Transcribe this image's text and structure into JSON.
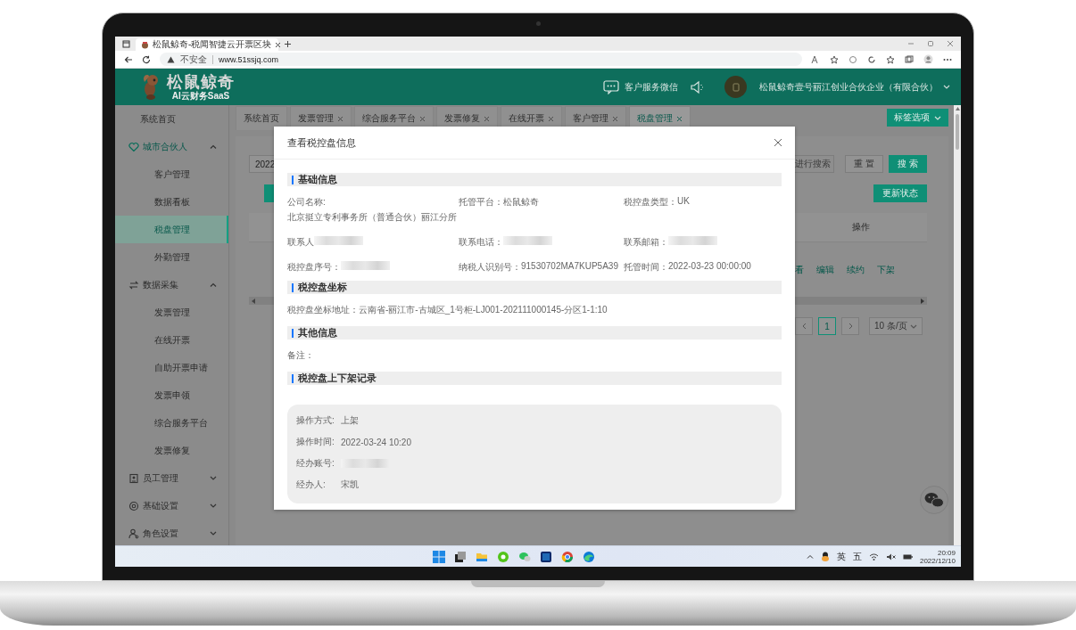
{
  "browser": {
    "tab_title": "松鼠鲸奇-税闻智捷云开票区块",
    "security": "不安全",
    "url": "www.51ssjq.com"
  },
  "header": {
    "logo": "松鼠鲸奇",
    "slogan": "AI云财务SaaS",
    "service": "客户服务微信",
    "company": "松鼠鲸奇壹号丽江创业合伙企业（有限合伙）"
  },
  "sidebar": [
    {
      "kind": "link",
      "label": "系统首页",
      "selected": false
    },
    {
      "kind": "group",
      "label": "城市合伙人",
      "expanded": true,
      "children": [
        {
          "label": "客户管理",
          "selected": false
        },
        {
          "label": "数据看板",
          "selected": false
        },
        {
          "label": "税盘管理",
          "selected": true
        },
        {
          "label": "外勤管理",
          "selected": false
        }
      ]
    },
    {
      "kind": "group",
      "label": "数据采集",
      "expanded": true,
      "children": [
        {
          "label": "发票管理",
          "selected": false
        },
        {
          "label": "在线开票",
          "selected": false
        },
        {
          "label": "自助开票申请",
          "selected": false
        },
        {
          "label": "发票申领",
          "selected": false
        },
        {
          "label": "综合服务平台",
          "selected": false
        },
        {
          "label": "发票修复",
          "selected": false
        }
      ]
    },
    {
      "kind": "group",
      "label": "员工管理",
      "expanded": false
    },
    {
      "kind": "group",
      "label": "基础设置",
      "expanded": false
    },
    {
      "kind": "group",
      "label": "角色设置",
      "expanded": false
    }
  ],
  "tabs": [
    {
      "label": "系统首页",
      "closable": false,
      "selected": false
    },
    {
      "label": "发票管理",
      "closable": true,
      "selected": false
    },
    {
      "label": "综合服务平台",
      "closable": true,
      "selected": false
    },
    {
      "label": "发票修复",
      "closable": true,
      "selected": false
    },
    {
      "label": "在线开票",
      "closable": true,
      "selected": false
    },
    {
      "label": "客户管理",
      "closable": true,
      "selected": false
    },
    {
      "label": "税盘管理",
      "closable": true,
      "selected": true
    }
  ],
  "tab_options": "标签选项",
  "toolbar": {
    "date_value": "2022",
    "search_placeholder": "进行搜索",
    "reset": "重 置",
    "search": "搜 索",
    "update": "更新状态"
  },
  "table": {
    "columns": [
      {
        "label": "操作"
      }
    ],
    "actions": [
      "看",
      "编辑",
      "续约",
      "下架"
    ]
  },
  "pagination": {
    "pages": [
      {
        "label": "1",
        "selected": true
      }
    ],
    "page_size": "10 条/页"
  },
  "modal": {
    "title": "查看税控盘信息",
    "sections": [
      {
        "title": "基础信息",
        "kind": "grid",
        "fields": [
          {
            "label": "公司名称:",
            "value": "北京挺立专利事务所（普通合伙）丽江分所",
            "kind": "stacked"
          },
          {
            "label": "托管平台：",
            "value": "松鼠鲸奇",
            "kind": "inline"
          },
          {
            "label": "税控盘类型：",
            "value": "UK",
            "kind": "inline"
          },
          {
            "label": "联系人",
            "kind": "inline",
            "redacted": true
          },
          {
            "label": "联系电话：",
            "kind": "inline",
            "redacted": true
          },
          {
            "label": "联系邮箱：",
            "kind": "inline",
            "redacted": true
          },
          {
            "label": "税控盘序号：",
            "kind": "inline",
            "redacted": true
          },
          {
            "label": "纳税人识别号：",
            "value": "91530702MA7KUP5A39",
            "kind": "inline"
          },
          {
            "label": "托管时间：",
            "value": "2022-03-23 00:00:00",
            "kind": "inline"
          }
        ]
      },
      {
        "title": "税控盘坐标",
        "kind": "list",
        "fields": [
          {
            "label": "税控盘坐标地址：",
            "value": "云南省-丽江市-古城区_1号柜-LJ001-202111000145-分区1-1:10",
            "kind": "inline"
          }
        ]
      },
      {
        "title": "其他信息",
        "kind": "list",
        "fields": [
          {
            "label": "备注：",
            "kind": "inline"
          }
        ]
      },
      {
        "title": "税控盘上下架记录",
        "kind": "record",
        "fields": [
          {
            "label": "操作方式:",
            "value": "上架",
            "kind": "inline"
          },
          {
            "label": "操作时间:",
            "value": "2022-03-24 10:20",
            "kind": "inline"
          },
          {
            "label": "经办账号:",
            "kind": "inline",
            "redacted": true
          },
          {
            "label": "经办人:",
            "value": "宋凯",
            "kind": "inline"
          }
        ]
      }
    ]
  },
  "taskbar": {
    "ime": "英",
    "ime_mode": "五",
    "time": "20:09",
    "date": "2022/12/10"
  }
}
